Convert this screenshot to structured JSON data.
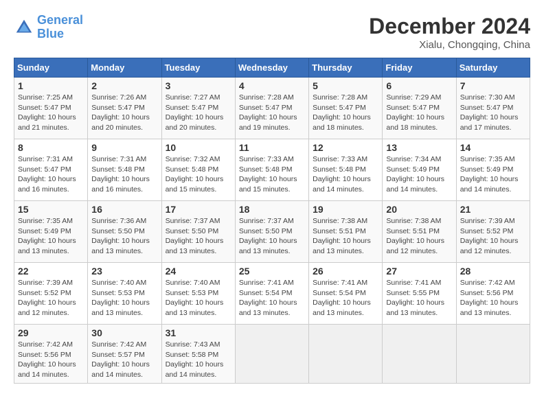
{
  "header": {
    "logo_line1": "General",
    "logo_line2": "Blue",
    "month": "December 2024",
    "location": "Xialu, Chongqing, China"
  },
  "weekdays": [
    "Sunday",
    "Monday",
    "Tuesday",
    "Wednesday",
    "Thursday",
    "Friday",
    "Saturday"
  ],
  "weeks": [
    [
      {
        "day": "1",
        "info": "Sunrise: 7:25 AM\nSunset: 5:47 PM\nDaylight: 10 hours\nand 21 minutes."
      },
      {
        "day": "2",
        "info": "Sunrise: 7:26 AM\nSunset: 5:47 PM\nDaylight: 10 hours\nand 20 minutes."
      },
      {
        "day": "3",
        "info": "Sunrise: 7:27 AM\nSunset: 5:47 PM\nDaylight: 10 hours\nand 20 minutes."
      },
      {
        "day": "4",
        "info": "Sunrise: 7:28 AM\nSunset: 5:47 PM\nDaylight: 10 hours\nand 19 minutes."
      },
      {
        "day": "5",
        "info": "Sunrise: 7:28 AM\nSunset: 5:47 PM\nDaylight: 10 hours\nand 18 minutes."
      },
      {
        "day": "6",
        "info": "Sunrise: 7:29 AM\nSunset: 5:47 PM\nDaylight: 10 hours\nand 18 minutes."
      },
      {
        "day": "7",
        "info": "Sunrise: 7:30 AM\nSunset: 5:47 PM\nDaylight: 10 hours\nand 17 minutes."
      }
    ],
    [
      {
        "day": "8",
        "info": "Sunrise: 7:31 AM\nSunset: 5:47 PM\nDaylight: 10 hours\nand 16 minutes."
      },
      {
        "day": "9",
        "info": "Sunrise: 7:31 AM\nSunset: 5:48 PM\nDaylight: 10 hours\nand 16 minutes."
      },
      {
        "day": "10",
        "info": "Sunrise: 7:32 AM\nSunset: 5:48 PM\nDaylight: 10 hours\nand 15 minutes."
      },
      {
        "day": "11",
        "info": "Sunrise: 7:33 AM\nSunset: 5:48 PM\nDaylight: 10 hours\nand 15 minutes."
      },
      {
        "day": "12",
        "info": "Sunrise: 7:33 AM\nSunset: 5:48 PM\nDaylight: 10 hours\nand 14 minutes."
      },
      {
        "day": "13",
        "info": "Sunrise: 7:34 AM\nSunset: 5:49 PM\nDaylight: 10 hours\nand 14 minutes."
      },
      {
        "day": "14",
        "info": "Sunrise: 7:35 AM\nSunset: 5:49 PM\nDaylight: 10 hours\nand 14 minutes."
      }
    ],
    [
      {
        "day": "15",
        "info": "Sunrise: 7:35 AM\nSunset: 5:49 PM\nDaylight: 10 hours\nand 13 minutes."
      },
      {
        "day": "16",
        "info": "Sunrise: 7:36 AM\nSunset: 5:50 PM\nDaylight: 10 hours\nand 13 minutes."
      },
      {
        "day": "17",
        "info": "Sunrise: 7:37 AM\nSunset: 5:50 PM\nDaylight: 10 hours\nand 13 minutes."
      },
      {
        "day": "18",
        "info": "Sunrise: 7:37 AM\nSunset: 5:50 PM\nDaylight: 10 hours\nand 13 minutes."
      },
      {
        "day": "19",
        "info": "Sunrise: 7:38 AM\nSunset: 5:51 PM\nDaylight: 10 hours\nand 13 minutes."
      },
      {
        "day": "20",
        "info": "Sunrise: 7:38 AM\nSunset: 5:51 PM\nDaylight: 10 hours\nand 12 minutes."
      },
      {
        "day": "21",
        "info": "Sunrise: 7:39 AM\nSunset: 5:52 PM\nDaylight: 10 hours\nand 12 minutes."
      }
    ],
    [
      {
        "day": "22",
        "info": "Sunrise: 7:39 AM\nSunset: 5:52 PM\nDaylight: 10 hours\nand 12 minutes."
      },
      {
        "day": "23",
        "info": "Sunrise: 7:40 AM\nSunset: 5:53 PM\nDaylight: 10 hours\nand 13 minutes."
      },
      {
        "day": "24",
        "info": "Sunrise: 7:40 AM\nSunset: 5:53 PM\nDaylight: 10 hours\nand 13 minutes."
      },
      {
        "day": "25",
        "info": "Sunrise: 7:41 AM\nSunset: 5:54 PM\nDaylight: 10 hours\nand 13 minutes."
      },
      {
        "day": "26",
        "info": "Sunrise: 7:41 AM\nSunset: 5:54 PM\nDaylight: 10 hours\nand 13 minutes."
      },
      {
        "day": "27",
        "info": "Sunrise: 7:41 AM\nSunset: 5:55 PM\nDaylight: 10 hours\nand 13 minutes."
      },
      {
        "day": "28",
        "info": "Sunrise: 7:42 AM\nSunset: 5:56 PM\nDaylight: 10 hours\nand 13 minutes."
      }
    ],
    [
      {
        "day": "29",
        "info": "Sunrise: 7:42 AM\nSunset: 5:56 PM\nDaylight: 10 hours\nand 14 minutes."
      },
      {
        "day": "30",
        "info": "Sunrise: 7:42 AM\nSunset: 5:57 PM\nDaylight: 10 hours\nand 14 minutes."
      },
      {
        "day": "31",
        "info": "Sunrise: 7:43 AM\nSunset: 5:58 PM\nDaylight: 10 hours\nand 14 minutes."
      },
      {
        "day": "",
        "info": ""
      },
      {
        "day": "",
        "info": ""
      },
      {
        "day": "",
        "info": ""
      },
      {
        "day": "",
        "info": ""
      }
    ]
  ]
}
